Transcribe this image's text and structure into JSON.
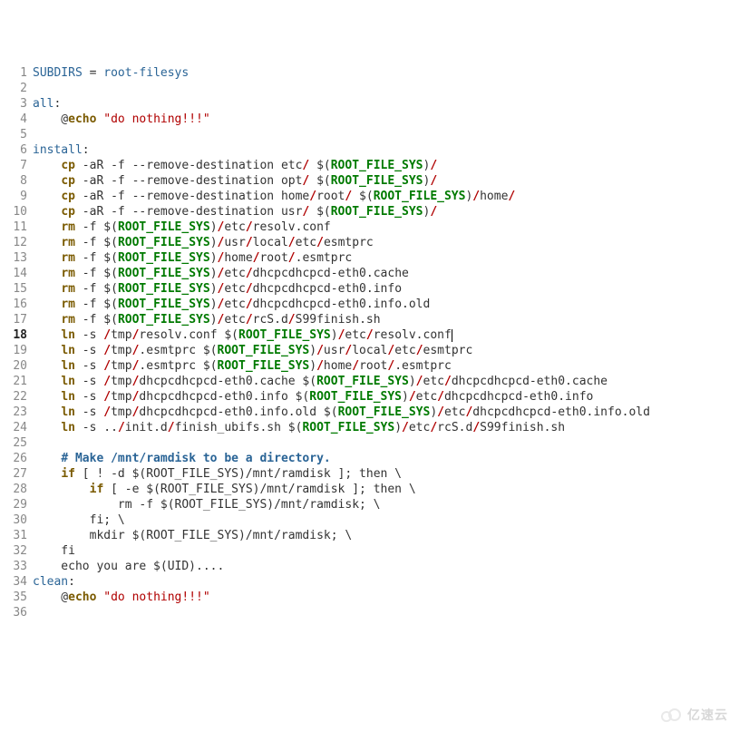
{
  "watermark_text": "亿速云",
  "current_line": 18,
  "lines": [
    {
      "n": 1,
      "tokens": [
        [
          "id",
          "SUBDIRS"
        ],
        [
          "p",
          " = "
        ],
        [
          "id",
          "root-filesys"
        ]
      ]
    },
    {
      "n": 2,
      "tokens": []
    },
    {
      "n": 3,
      "tokens": [
        [
          "id",
          "all"
        ],
        [
          "p",
          ":"
        ]
      ]
    },
    {
      "n": 4,
      "tokens": [
        [
          "p",
          "    @"
        ],
        [
          "cmd",
          "echo"
        ],
        [
          "p",
          " "
        ],
        [
          "str",
          "\"do nothing!!!\""
        ]
      ]
    },
    {
      "n": 5,
      "tokens": []
    },
    {
      "n": 6,
      "tokens": [
        [
          "id",
          "install"
        ],
        [
          "p",
          ":"
        ]
      ]
    },
    {
      "n": 7,
      "tokens": [
        [
          "p",
          "    "
        ],
        [
          "cmd",
          "cp"
        ],
        [
          "p",
          " -aR -f --remove-destination etc"
        ],
        [
          "sl",
          "/"
        ],
        [
          "p",
          " $("
        ],
        [
          "var",
          "ROOT_FILE_SYS"
        ],
        [
          "p",
          ")"
        ],
        [
          "sl",
          "/"
        ]
      ]
    },
    {
      "n": 8,
      "tokens": [
        [
          "p",
          "    "
        ],
        [
          "cmd",
          "cp"
        ],
        [
          "p",
          " -aR -f --remove-destination opt"
        ],
        [
          "sl",
          "/"
        ],
        [
          "p",
          " $("
        ],
        [
          "var",
          "ROOT_FILE_SYS"
        ],
        [
          "p",
          ")"
        ],
        [
          "sl",
          "/"
        ]
      ]
    },
    {
      "n": 9,
      "tokens": [
        [
          "p",
          "    "
        ],
        [
          "cmd",
          "cp"
        ],
        [
          "p",
          " -aR -f --remove-destination home"
        ],
        [
          "sl",
          "/"
        ],
        [
          "p",
          "root"
        ],
        [
          "sl",
          "/"
        ],
        [
          "p",
          " $("
        ],
        [
          "var",
          "ROOT_FILE_SYS"
        ],
        [
          "p",
          ")"
        ],
        [
          "sl",
          "/"
        ],
        [
          "p",
          "home"
        ],
        [
          "sl",
          "/"
        ]
      ]
    },
    {
      "n": 10,
      "tokens": [
        [
          "p",
          "    "
        ],
        [
          "cmd",
          "cp"
        ],
        [
          "p",
          " -aR -f --remove-destination usr"
        ],
        [
          "sl",
          "/"
        ],
        [
          "p",
          " $("
        ],
        [
          "var",
          "ROOT_FILE_SYS"
        ],
        [
          "p",
          ")"
        ],
        [
          "sl",
          "/"
        ]
      ]
    },
    {
      "n": 11,
      "tokens": [
        [
          "p",
          "    "
        ],
        [
          "cmd",
          "rm"
        ],
        [
          "p",
          " -f $("
        ],
        [
          "var",
          "ROOT_FILE_SYS"
        ],
        [
          "p",
          ")"
        ],
        [
          "sl",
          "/"
        ],
        [
          "p",
          "etc"
        ],
        [
          "sl",
          "/"
        ],
        [
          "p",
          "resolv.conf"
        ]
      ]
    },
    {
      "n": 12,
      "tokens": [
        [
          "p",
          "    "
        ],
        [
          "cmd",
          "rm"
        ],
        [
          "p",
          " -f $("
        ],
        [
          "var",
          "ROOT_FILE_SYS"
        ],
        [
          "p",
          ")"
        ],
        [
          "sl",
          "/"
        ],
        [
          "p",
          "usr"
        ],
        [
          "sl",
          "/"
        ],
        [
          "p",
          "local"
        ],
        [
          "sl",
          "/"
        ],
        [
          "p",
          "etc"
        ],
        [
          "sl",
          "/"
        ],
        [
          "p",
          "esmtprc"
        ]
      ]
    },
    {
      "n": 13,
      "tokens": [
        [
          "p",
          "    "
        ],
        [
          "cmd",
          "rm"
        ],
        [
          "p",
          " -f $("
        ],
        [
          "var",
          "ROOT_FILE_SYS"
        ],
        [
          "p",
          ")"
        ],
        [
          "sl",
          "/"
        ],
        [
          "p",
          "home"
        ],
        [
          "sl",
          "/"
        ],
        [
          "p",
          "root"
        ],
        [
          "sl",
          "/"
        ],
        [
          "p",
          ".esmtprc"
        ]
      ]
    },
    {
      "n": 14,
      "tokens": [
        [
          "p",
          "    "
        ],
        [
          "cmd",
          "rm"
        ],
        [
          "p",
          " -f $("
        ],
        [
          "var",
          "ROOT_FILE_SYS"
        ],
        [
          "p",
          ")"
        ],
        [
          "sl",
          "/"
        ],
        [
          "p",
          "etc"
        ],
        [
          "sl",
          "/"
        ],
        [
          "p",
          "dhcpcdhcpcd-eth0.cache"
        ]
      ]
    },
    {
      "n": 15,
      "tokens": [
        [
          "p",
          "    "
        ],
        [
          "cmd",
          "rm"
        ],
        [
          "p",
          " -f $("
        ],
        [
          "var",
          "ROOT_FILE_SYS"
        ],
        [
          "p",
          ")"
        ],
        [
          "sl",
          "/"
        ],
        [
          "p",
          "etc"
        ],
        [
          "sl",
          "/"
        ],
        [
          "p",
          "dhcpcdhcpcd-eth0.info"
        ]
      ]
    },
    {
      "n": 16,
      "tokens": [
        [
          "p",
          "    "
        ],
        [
          "cmd",
          "rm"
        ],
        [
          "p",
          " -f $("
        ],
        [
          "var",
          "ROOT_FILE_SYS"
        ],
        [
          "p",
          ")"
        ],
        [
          "sl",
          "/"
        ],
        [
          "p",
          "etc"
        ],
        [
          "sl",
          "/"
        ],
        [
          "p",
          "dhcpcdhcpcd-eth0.info.old"
        ]
      ]
    },
    {
      "n": 17,
      "tokens": [
        [
          "p",
          "    "
        ],
        [
          "cmd",
          "rm"
        ],
        [
          "p",
          " -f $("
        ],
        [
          "var",
          "ROOT_FILE_SYS"
        ],
        [
          "p",
          ")"
        ],
        [
          "sl",
          "/"
        ],
        [
          "p",
          "etc"
        ],
        [
          "sl",
          "/"
        ],
        [
          "p",
          "rcS.d"
        ],
        [
          "sl",
          "/"
        ],
        [
          "p",
          "S99finish.sh"
        ]
      ]
    },
    {
      "n": 18,
      "tokens": [
        [
          "p",
          "    "
        ],
        [
          "cmd",
          "ln"
        ],
        [
          "p",
          " -s "
        ],
        [
          "sl",
          "/"
        ],
        [
          "p",
          "tmp"
        ],
        [
          "sl",
          "/"
        ],
        [
          "p",
          "resolv.conf $("
        ],
        [
          "var",
          "ROOT_FILE_SYS"
        ],
        [
          "p",
          ")"
        ],
        [
          "sl",
          "/"
        ],
        [
          "p",
          "etc"
        ],
        [
          "sl",
          "/"
        ],
        [
          "p",
          "resolv.conf"
        ],
        [
          "cur",
          ""
        ]
      ]
    },
    {
      "n": 19,
      "tokens": [
        [
          "p",
          "    "
        ],
        [
          "cmd",
          "ln"
        ],
        [
          "p",
          " -s "
        ],
        [
          "sl",
          "/"
        ],
        [
          "p",
          "tmp"
        ],
        [
          "sl",
          "/"
        ],
        [
          "p",
          ".esmtprc $("
        ],
        [
          "var",
          "ROOT_FILE_SYS"
        ],
        [
          "p",
          ")"
        ],
        [
          "sl",
          "/"
        ],
        [
          "p",
          "usr"
        ],
        [
          "sl",
          "/"
        ],
        [
          "p",
          "local"
        ],
        [
          "sl",
          "/"
        ],
        [
          "p",
          "etc"
        ],
        [
          "sl",
          "/"
        ],
        [
          "p",
          "esmtprc"
        ]
      ]
    },
    {
      "n": 20,
      "tokens": [
        [
          "p",
          "    "
        ],
        [
          "cmd",
          "ln"
        ],
        [
          "p",
          " -s "
        ],
        [
          "sl",
          "/"
        ],
        [
          "p",
          "tmp"
        ],
        [
          "sl",
          "/"
        ],
        [
          "p",
          ".esmtprc $("
        ],
        [
          "var",
          "ROOT_FILE_SYS"
        ],
        [
          "p",
          ")"
        ],
        [
          "sl",
          "/"
        ],
        [
          "p",
          "home"
        ],
        [
          "sl",
          "/"
        ],
        [
          "p",
          "root"
        ],
        [
          "sl",
          "/"
        ],
        [
          "p",
          ".esmtprc"
        ]
      ]
    },
    {
      "n": 21,
      "tokens": [
        [
          "p",
          "    "
        ],
        [
          "cmd",
          "ln"
        ],
        [
          "p",
          " -s "
        ],
        [
          "sl",
          "/"
        ],
        [
          "p",
          "tmp"
        ],
        [
          "sl",
          "/"
        ],
        [
          "p",
          "dhcpcdhcpcd-eth0.cache $("
        ],
        [
          "var",
          "ROOT_FILE_SYS"
        ],
        [
          "p",
          ")"
        ],
        [
          "sl",
          "/"
        ],
        [
          "p",
          "etc"
        ],
        [
          "sl",
          "/"
        ],
        [
          "p",
          "dhcpcdhcpcd-eth0.cache"
        ]
      ]
    },
    {
      "n": 22,
      "tokens": [
        [
          "p",
          "    "
        ],
        [
          "cmd",
          "ln"
        ],
        [
          "p",
          " -s "
        ],
        [
          "sl",
          "/"
        ],
        [
          "p",
          "tmp"
        ],
        [
          "sl",
          "/"
        ],
        [
          "p",
          "dhcpcdhcpcd-eth0.info $("
        ],
        [
          "var",
          "ROOT_FILE_SYS"
        ],
        [
          "p",
          ")"
        ],
        [
          "sl",
          "/"
        ],
        [
          "p",
          "etc"
        ],
        [
          "sl",
          "/"
        ],
        [
          "p",
          "dhcpcdhcpcd-eth0.info"
        ]
      ]
    },
    {
      "n": 23,
      "tokens": [
        [
          "p",
          "    "
        ],
        [
          "cmd",
          "ln"
        ],
        [
          "p",
          " -s "
        ],
        [
          "sl",
          "/"
        ],
        [
          "p",
          "tmp"
        ],
        [
          "sl",
          "/"
        ],
        [
          "p",
          "dhcpcdhcpcd-eth0.info.old $("
        ],
        [
          "var",
          "ROOT_FILE_SYS"
        ],
        [
          "p",
          ")"
        ],
        [
          "sl",
          "/"
        ],
        [
          "p",
          "etc"
        ],
        [
          "sl",
          "/"
        ],
        [
          "p",
          "dhcpcdhcpcd-eth0.info.old"
        ]
      ]
    },
    {
      "n": 24,
      "tokens": [
        [
          "p",
          "    "
        ],
        [
          "cmd",
          "ln"
        ],
        [
          "p",
          " -s .."
        ],
        [
          "sl",
          "/"
        ],
        [
          "p",
          "init.d"
        ],
        [
          "sl",
          "/"
        ],
        [
          "p",
          "finish_ubifs.sh $("
        ],
        [
          "var",
          "ROOT_FILE_SYS"
        ],
        [
          "p",
          ")"
        ],
        [
          "sl",
          "/"
        ],
        [
          "p",
          "etc"
        ],
        [
          "sl",
          "/"
        ],
        [
          "p",
          "rcS.d"
        ],
        [
          "sl",
          "/"
        ],
        [
          "p",
          "S99finish.sh"
        ]
      ]
    },
    {
      "n": 25,
      "tokens": []
    },
    {
      "n": 26,
      "tokens": [
        [
          "p",
          "    "
        ],
        [
          "cmt",
          "# Make /mnt/ramdisk to be a directory."
        ]
      ]
    },
    {
      "n": 27,
      "tokens": [
        [
          "p",
          "    "
        ],
        [
          "cmd",
          "if"
        ],
        [
          "p",
          " [ ! -d $(ROOT_FILE_SYS)/mnt/ramdisk ]; then \\"
        ]
      ]
    },
    {
      "n": 28,
      "tokens": [
        [
          "p",
          "        "
        ],
        [
          "cmd",
          "if"
        ],
        [
          "p",
          " [ -e $(ROOT_FILE_SYS)/mnt/ramdisk ]; then \\"
        ]
      ]
    },
    {
      "n": 29,
      "tokens": [
        [
          "p",
          "            rm -f $(ROOT_FILE_SYS)/mnt/ramdisk; \\"
        ]
      ]
    },
    {
      "n": 30,
      "tokens": [
        [
          "p",
          "        fi; \\"
        ]
      ]
    },
    {
      "n": 31,
      "tokens": [
        [
          "p",
          "        mkdir $(ROOT_FILE_SYS)/mnt/ramdisk; \\"
        ]
      ]
    },
    {
      "n": 32,
      "tokens": [
        [
          "p",
          "    fi"
        ]
      ]
    },
    {
      "n": 33,
      "tokens": [
        [
          "p",
          "    echo you are $(UID)...."
        ]
      ]
    },
    {
      "n": 34,
      "tokens": [
        [
          "id",
          "clean"
        ],
        [
          "p",
          ":"
        ]
      ]
    },
    {
      "n": 35,
      "tokens": [
        [
          "p",
          "    @"
        ],
        [
          "cmd",
          "echo"
        ],
        [
          "p",
          " "
        ],
        [
          "str",
          "\"do nothing!!!\""
        ]
      ]
    },
    {
      "n": 36,
      "tokens": []
    }
  ]
}
